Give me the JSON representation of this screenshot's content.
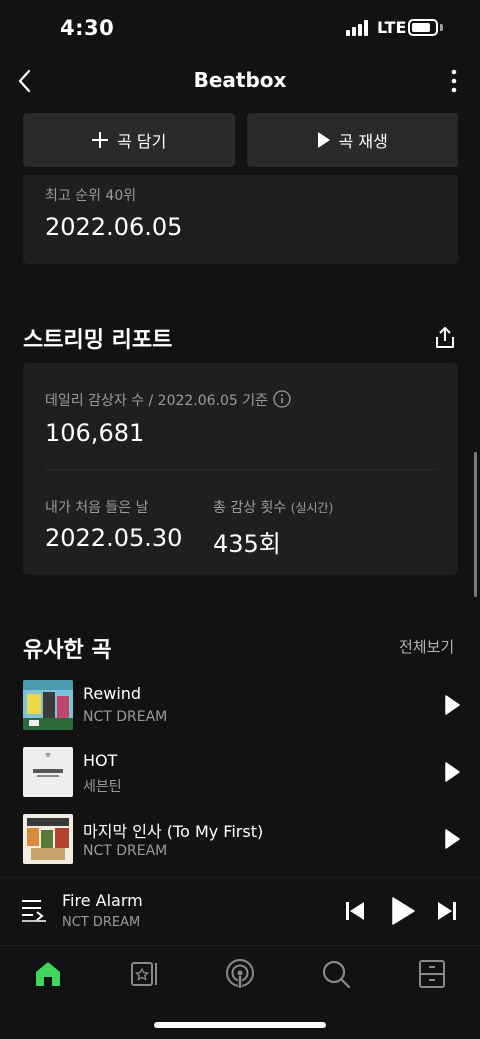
{
  "status": {
    "time": "4:30",
    "network": "LTE",
    "battery_level": 0.8
  },
  "header": {
    "title": "Beatbox"
  },
  "actions": {
    "add_label": "곡 담기",
    "play_label": "곡 재생"
  },
  "rank": {
    "label": "최고 순위 40위",
    "date": "2022.06.05"
  },
  "report": {
    "title": "스트리밍 리포트",
    "daily_label": "데일리 감상자 수 / 2022.06.05 기준",
    "daily_value": "106,681",
    "first_label": "내가 처음 들은 날",
    "first_value": "2022.05.30",
    "total_label": "총 감상 횟수",
    "total_suffix": "(실시간)",
    "total_value": "435회"
  },
  "similar": {
    "title": "유사한 곡",
    "see_all": "전체보기",
    "tracks": [
      {
        "title": "Rewind",
        "artist": "NCT DREAM"
      },
      {
        "title": "HOT",
        "artist": "세븐틴"
      },
      {
        "title": "마지막 인사 (To My First)",
        "artist": "NCT DREAM"
      }
    ]
  },
  "player": {
    "title": "Fire Alarm",
    "artist": "NCT DREAM"
  },
  "tabs": [
    "home-icon",
    "library-icon",
    "podcast-icon",
    "search-icon",
    "storage-icon"
  ],
  "colors": {
    "background": "#121212",
    "card": "#1f1f1f",
    "button": "#2a2a2a",
    "accent": "#3fd65b"
  }
}
